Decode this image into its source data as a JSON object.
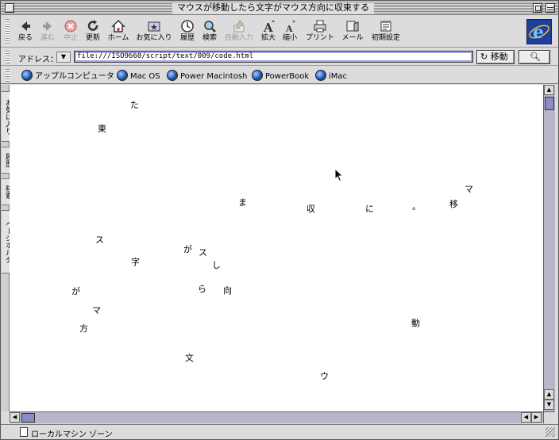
{
  "window": {
    "title": "マウスが移動したら文字がマウス方向に収束する"
  },
  "toolbar": {
    "buttons": [
      {
        "label": "戻る",
        "icon": "back-arrow-icon",
        "enabled": true
      },
      {
        "label": "進む",
        "icon": "forward-arrow-icon",
        "enabled": false
      },
      {
        "label": "中止",
        "icon": "stop-icon",
        "enabled": false
      },
      {
        "label": "更新",
        "icon": "refresh-icon",
        "enabled": true
      },
      {
        "label": "ホーム",
        "icon": "home-icon",
        "enabled": true
      },
      {
        "label": "お気に入り",
        "icon": "favorites-icon",
        "enabled": true
      },
      {
        "label": "履歴",
        "icon": "history-icon",
        "enabled": true
      },
      {
        "label": "検索",
        "icon": "search-icon",
        "enabled": true
      },
      {
        "label": "自動入力",
        "icon": "autofill-icon",
        "enabled": false
      },
      {
        "label": "拡大",
        "icon": "text-larger-icon",
        "enabled": true
      },
      {
        "label": "縮小",
        "icon": "text-smaller-icon",
        "enabled": true
      },
      {
        "label": "プリント",
        "icon": "print-icon",
        "enabled": true
      },
      {
        "label": "メール",
        "icon": "mail-icon",
        "enabled": true
      },
      {
        "label": "初期設定",
        "icon": "preferences-icon",
        "enabled": true
      }
    ]
  },
  "address": {
    "label": "アドレス：",
    "url": "file:///ISO9660/script/text/009/code.html",
    "go_label": "移動"
  },
  "favorites": [
    "アップルコンピュータ",
    "Mac OS",
    "Power Macintosh",
    "PowerBook",
    "iMac"
  ],
  "side_tabs": [
    "お気に入り",
    "履歴",
    "検索",
    "ページホルダ"
  ],
  "content": {
    "chars": [
      "た",
      "東",
      "ま",
      "収",
      "に",
      "。",
      "マ",
      "移",
      "ス",
      "字",
      "が",
      "ス",
      "し",
      "ら",
      "向",
      "が",
      "マ",
      "方",
      "動",
      "文",
      "ウ"
    ]
  },
  "status": {
    "text": "ローカルマシン ゾーン"
  },
  "colors": {
    "accent": "#8b8bc7",
    "address_highlight": "#a8a8e8"
  }
}
